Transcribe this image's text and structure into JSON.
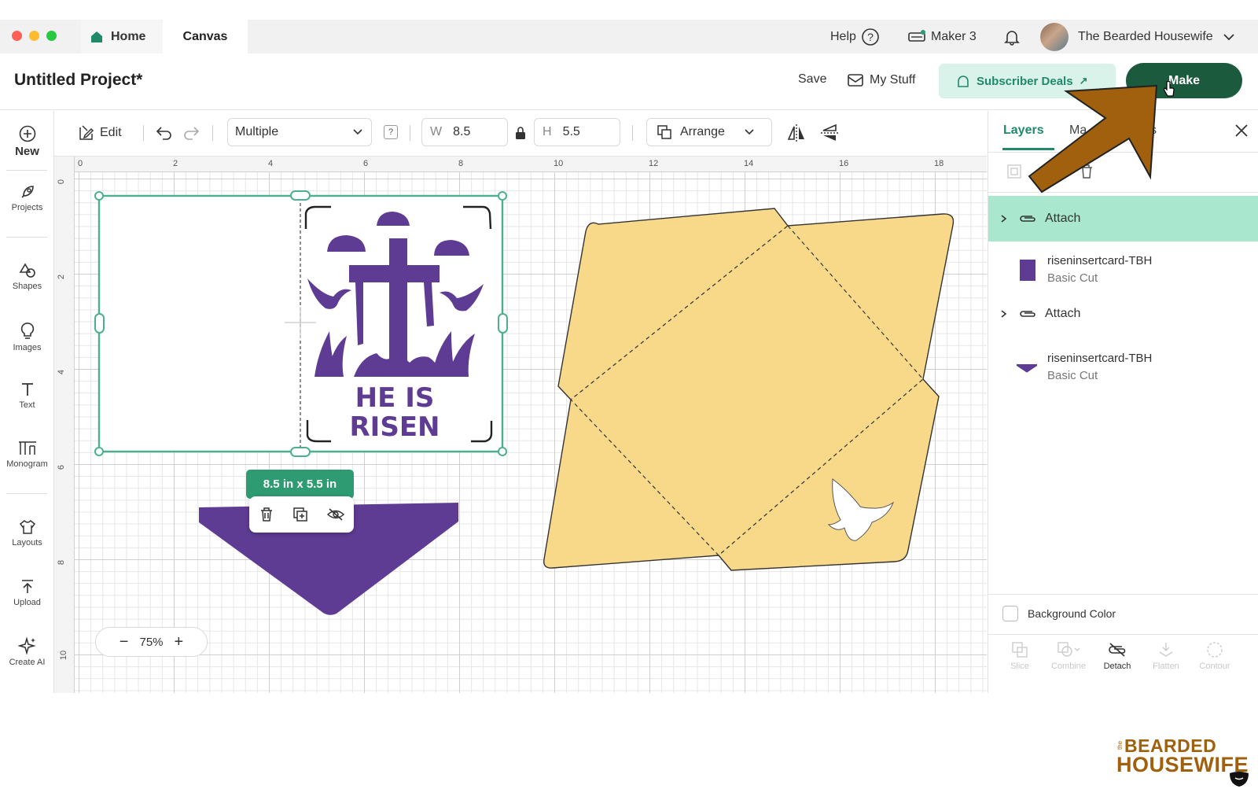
{
  "titlebar": {
    "tabs": [
      {
        "label": "Home"
      },
      {
        "label": "Canvas"
      }
    ],
    "help_label": "Help",
    "machine_label": "Maker 3",
    "user_name": "The Bearded Housewife"
  },
  "project": {
    "title": "Untitled Project*",
    "save_label": "Save",
    "mystuff_label": "My Stuff",
    "deals_label": "Subscriber Deals",
    "make_label": "Make"
  },
  "sidebar": {
    "items": [
      {
        "label": "New",
        "icon": "plus-circle-icon"
      },
      {
        "label": "Projects",
        "icon": "rocket-icon"
      },
      {
        "label": "Shapes",
        "icon": "shapes-icon"
      },
      {
        "label": "Images",
        "icon": "bulb-icon"
      },
      {
        "label": "Text",
        "icon": "text-icon"
      },
      {
        "label": "Monogram",
        "icon": "monogram-icon"
      },
      {
        "label": "Layouts",
        "icon": "shirt-icon"
      },
      {
        "label": "Upload",
        "icon": "upload-icon"
      },
      {
        "label": "Create AI",
        "icon": "sparkle-icon"
      }
    ]
  },
  "toolbar": {
    "edit_label": "Edit",
    "operation_value": "Multiple",
    "help_badge": "?",
    "width_label": "W",
    "width_value": "8.5",
    "height_label": "H",
    "height_value": "5.5",
    "arrange_label": "Arrange"
  },
  "canvas": {
    "ruler_top": [
      "0",
      "2",
      "4",
      "6",
      "8",
      "10",
      "12",
      "14",
      "16",
      "18"
    ],
    "ruler_left": [
      "0",
      "2",
      "4",
      "6",
      "8",
      "10"
    ],
    "card_text_line1": "HE IS",
    "card_text_line2": "RISEN",
    "size_badge": "8.5  in x 5.5  in",
    "zoom_value": "75%",
    "colors": {
      "purple": "#5f3c94",
      "envelope": "#f8d98a",
      "selection": "#4caf8d"
    }
  },
  "rpanel": {
    "tabs": [
      {
        "label": "Layers"
      },
      {
        "label": "Ma"
      },
      {
        "label": "s"
      }
    ],
    "layers": [
      {
        "type": "group",
        "label": "Attach",
        "selected": true
      },
      {
        "type": "item",
        "name": "riseninsertcard-TBH",
        "sub": "Basic Cut"
      },
      {
        "type": "group",
        "label": "Attach",
        "selected": false
      },
      {
        "type": "item",
        "name": "riseninsertcard-TBH",
        "sub": "Basic Cut"
      }
    ],
    "background_color_label": "Background Color",
    "bottom_tools": [
      {
        "label": "Slice",
        "enabled": false
      },
      {
        "label": "Combine",
        "enabled": false
      },
      {
        "label": "Detach",
        "enabled": true
      },
      {
        "label": "Flatten",
        "enabled": false
      },
      {
        "label": "Contour",
        "enabled": false
      }
    ]
  },
  "logo": {
    "line1": "BEARDED",
    "line2": "HOUSEWIFE",
    "prefix": "the"
  }
}
